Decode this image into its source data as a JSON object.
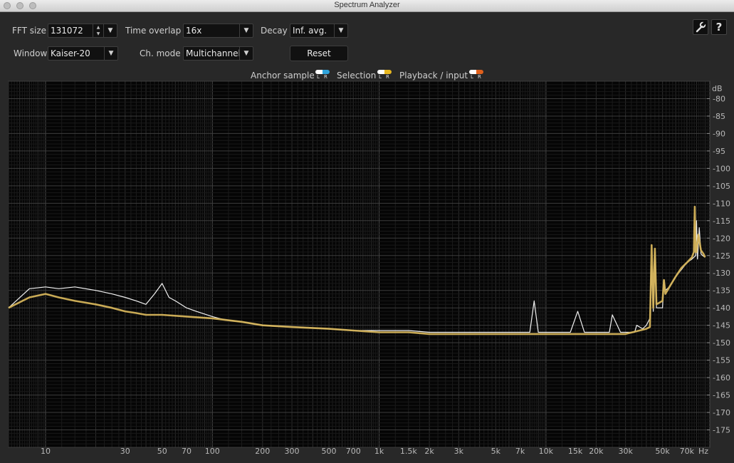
{
  "window": {
    "title": "Spectrum Analyzer"
  },
  "controls": {
    "fft_size": {
      "label": "FFT size",
      "value": "131072"
    },
    "time_overlap": {
      "label": "Time overlap",
      "value": "16x"
    },
    "decay": {
      "label": "Decay",
      "value": "Inf. avg."
    },
    "window_fn": {
      "label": "Window",
      "value": "Kaiser-20"
    },
    "channel_mode": {
      "label": "Ch. mode",
      "value": "Multichannel"
    },
    "reset_label": "Reset",
    "settings_icon": "wrench-icon",
    "help_glyph": "?"
  },
  "legend": {
    "items": [
      {
        "label": "Anchor sample",
        "left_color": "#ffffff",
        "right_color": "#2fa4dc"
      },
      {
        "label": "Selection",
        "left_color": "#ffffff",
        "right_color": "#e8b820"
      },
      {
        "label": "Playback / input",
        "left_color": "#ffffff",
        "right_color": "#e0601c"
      }
    ],
    "channel_l": "L",
    "channel_r": "R"
  },
  "chart_data": {
    "type": "line",
    "x_scale": "log",
    "xlim": [
      6,
      96000
    ],
    "ylim": [
      -180,
      -75
    ],
    "grid": true,
    "y_unit": "dB",
    "x_unit": "Hz",
    "x_tick_labels": [
      {
        "v": 10,
        "t": "10"
      },
      {
        "v": 30,
        "t": "30"
      },
      {
        "v": 50,
        "t": "50"
      },
      {
        "v": 70,
        "t": "70"
      },
      {
        "v": 100,
        "t": "100"
      },
      {
        "v": 200,
        "t": "200"
      },
      {
        "v": 300,
        "t": "300"
      },
      {
        "v": 500,
        "t": "500"
      },
      {
        "v": 700,
        "t": "700"
      },
      {
        "v": 1000,
        "t": "1k"
      },
      {
        "v": 1500,
        "t": "1.5k"
      },
      {
        "v": 2000,
        "t": "2k"
      },
      {
        "v": 3000,
        "t": "3k"
      },
      {
        "v": 5000,
        "t": "5k"
      },
      {
        "v": 7000,
        "t": "7k"
      },
      {
        "v": 10000,
        "t": "10k"
      },
      {
        "v": 15000,
        "t": "15k"
      },
      {
        "v": 20000,
        "t": "20k"
      },
      {
        "v": 30000,
        "t": "30k"
      },
      {
        "v": 50000,
        "t": "50k"
      },
      {
        "v": 70000,
        "t": "70k"
      }
    ],
    "y_tick_labels": [
      -80,
      -85,
      -90,
      -95,
      -100,
      -105,
      -110,
      -115,
      -120,
      -125,
      -130,
      -135,
      -140,
      -145,
      -150,
      -155,
      -160,
      -165,
      -170,
      -175
    ],
    "series": [
      {
        "color": "#f2f2f2",
        "x": [
          6,
          8,
          10,
          12,
          15,
          20,
          25,
          30,
          35,
          40,
          45,
          50,
          55,
          60,
          70,
          80,
          100,
          120,
          150,
          200,
          300,
          500,
          700,
          1000,
          1500,
          2000,
          3000,
          5000,
          7000,
          8000,
          8500,
          9000,
          10000,
          14000,
          15500,
          17000,
          20000,
          24000,
          25000,
          28000,
          30000,
          34000,
          35000,
          38000,
          40000,
          42000,
          43000,
          44000,
          45000,
          46000,
          50000,
          51000,
          52000,
          55000,
          60000,
          65000,
          70000,
          75000,
          79000,
          80000,
          81000,
          83000,
          85000,
          87000,
          90000
        ],
        "y": [
          -140,
          -134.5,
          -134,
          -134.5,
          -134,
          -135,
          -136,
          -137,
          -138,
          -139,
          -136,
          -133,
          -137,
          -138,
          -140,
          -141,
          -142.5,
          -143.5,
          -144,
          -145,
          -145.5,
          -146,
          -146.5,
          -146.5,
          -146.5,
          -147,
          -147,
          -147,
          -147,
          -147,
          -138,
          -147,
          -147,
          -147,
          -141,
          -147,
          -147,
          -147,
          -142,
          -147,
          -147,
          -147,
          -145,
          -146,
          -145,
          -143,
          -128,
          -141,
          -124,
          -140,
          -140,
          -132,
          -135,
          -134,
          -131,
          -129,
          -127,
          -126,
          -125,
          -115,
          -126,
          -117,
          -124.5,
          -125,
          -125.5
        ]
      },
      {
        "color": "#d4b35a",
        "x": [
          6,
          8,
          10,
          12,
          15,
          20,
          25,
          30,
          35,
          40,
          50,
          70,
          100,
          150,
          200,
          300,
          500,
          700,
          1000,
          1500,
          2000,
          3000,
          5000,
          7000,
          10000,
          15000,
          20000,
          30000,
          40000,
          42000,
          43000,
          44000,
          45000,
          46000,
          50000,
          51000,
          52000,
          55000,
          60000,
          65000,
          70000,
          75000,
          77000,
          78000,
          79000,
          80000,
          82000,
          85000,
          88000,
          90000
        ],
        "y": [
          -140,
          -137,
          -136,
          -137,
          -138,
          -139,
          -140,
          -141,
          -141.5,
          -142,
          -142,
          -142.5,
          -143,
          -144,
          -145,
          -145.5,
          -146,
          -146.5,
          -147,
          -147,
          -147.5,
          -147.5,
          -147.5,
          -147.5,
          -147.5,
          -147.5,
          -147.5,
          -147.5,
          -146,
          -145.5,
          -122,
          -140,
          -123,
          -139,
          -138,
          -132,
          -136,
          -134,
          -131,
          -128.5,
          -127,
          -125.5,
          -124,
          -111,
          -124,
          -124,
          -119,
          -123.5,
          -124.5,
          -125.5
        ]
      }
    ]
  }
}
